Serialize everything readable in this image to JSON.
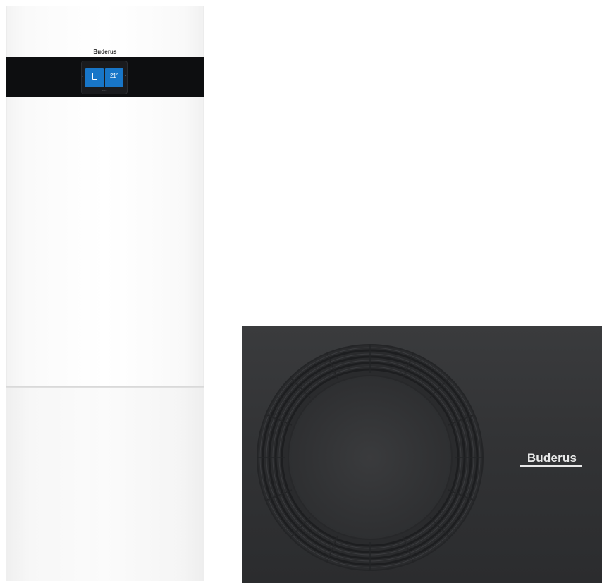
{
  "indoor_unit": {
    "brand": "Buderus",
    "display": {
      "status_bar": "",
      "left_tile_text": "",
      "right_tile_temperature": "21°",
      "right_tile_text": ""
    }
  },
  "outdoor_unit": {
    "brand": "Buderus"
  },
  "colors": {
    "indoor_body": "#ffffff",
    "control_band": "#0d0e10",
    "display_tile": "#1876c8",
    "outdoor_body": "#333436",
    "logo_text": "#e9e9e9"
  }
}
